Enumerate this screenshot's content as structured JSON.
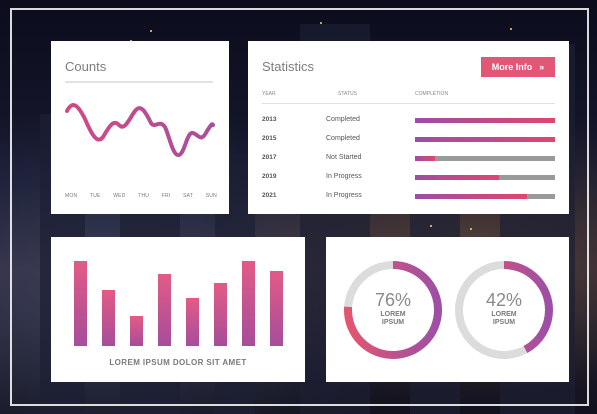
{
  "counts": {
    "title": "Counts",
    "days": [
      "MON",
      "TUE",
      "WED",
      "THU",
      "FRI",
      "SAT",
      "SUN"
    ],
    "accent": "#c24d92"
  },
  "statistics": {
    "title": "Statistics",
    "more_label": "More Info",
    "columns": [
      "YEAR",
      "STATUS",
      "COMPLETION"
    ],
    "rows": [
      {
        "year": "2013",
        "status": "Completed",
        "completion": 1.0
      },
      {
        "year": "2015",
        "status": "Completed",
        "completion": 1.0
      },
      {
        "year": "2017",
        "status": "Not Started",
        "completion": 0.14
      },
      {
        "year": "2019",
        "status": "In Progress",
        "completion": 0.6
      },
      {
        "year": "2021",
        "status": "In Progress",
        "completion": 0.8
      }
    ],
    "button_color": "#e35676"
  },
  "bar_panel": {
    "caption": "LOREM IPSUM DOLOR SIT AMET",
    "values": [
      92,
      61,
      33,
      78,
      52,
      69,
      92,
      81
    ]
  },
  "donuts": [
    {
      "value": 76,
      "label": "76%",
      "sub1": "LOREM",
      "sub2": "IPSUM"
    },
    {
      "value": 42,
      "label": "42%",
      "sub1": "LOREM",
      "sub2": "IPSUM"
    }
  ],
  "colors": {
    "pink": "#e3556f",
    "purple": "#9d4fa5",
    "track": "#dcdcdc"
  }
}
